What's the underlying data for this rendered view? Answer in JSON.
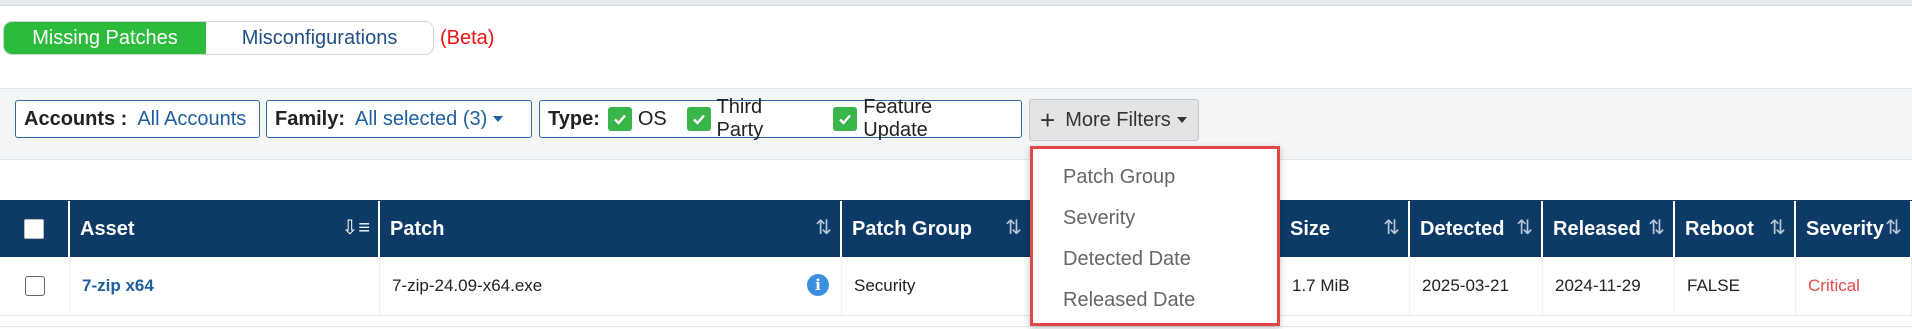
{
  "view_toggle": {
    "missing_patches": "Missing Patches",
    "misconfigurations": "Misconfigurations",
    "beta": "(Beta)",
    "active_color": "#2dbb3c"
  },
  "filters": {
    "accounts": {
      "label": "Accounts :",
      "value": "All Accounts"
    },
    "family": {
      "label": "Family:",
      "value": "All selected (3)"
    },
    "type": {
      "label": "Type:",
      "options": [
        {
          "label": "OS",
          "checked": true
        },
        {
          "label": "Third Party",
          "checked": true
        },
        {
          "label": "Feature Update",
          "checked": true
        }
      ]
    },
    "more_filters": "More Filters"
  },
  "more_filters_menu": {
    "items": [
      "Patch Group",
      "Severity",
      "Detected Date",
      "Released Date"
    ],
    "highlight_color": "#e04848"
  },
  "table": {
    "header_color": "#0d3a66",
    "columns": [
      "Asset",
      "Patch",
      "Patch Group",
      "",
      "Size",
      "Detected",
      "Released",
      "Reboot",
      "Severity"
    ],
    "rows": [
      {
        "asset": "7-zip x64",
        "patch": "7-zip-24.09-x64.exe",
        "patch_group": "Security",
        "size": "1.7 MiB",
        "detected": "2025-03-21",
        "released": "2024-11-29",
        "reboot": "FALSE",
        "severity": "Critical"
      }
    ]
  }
}
